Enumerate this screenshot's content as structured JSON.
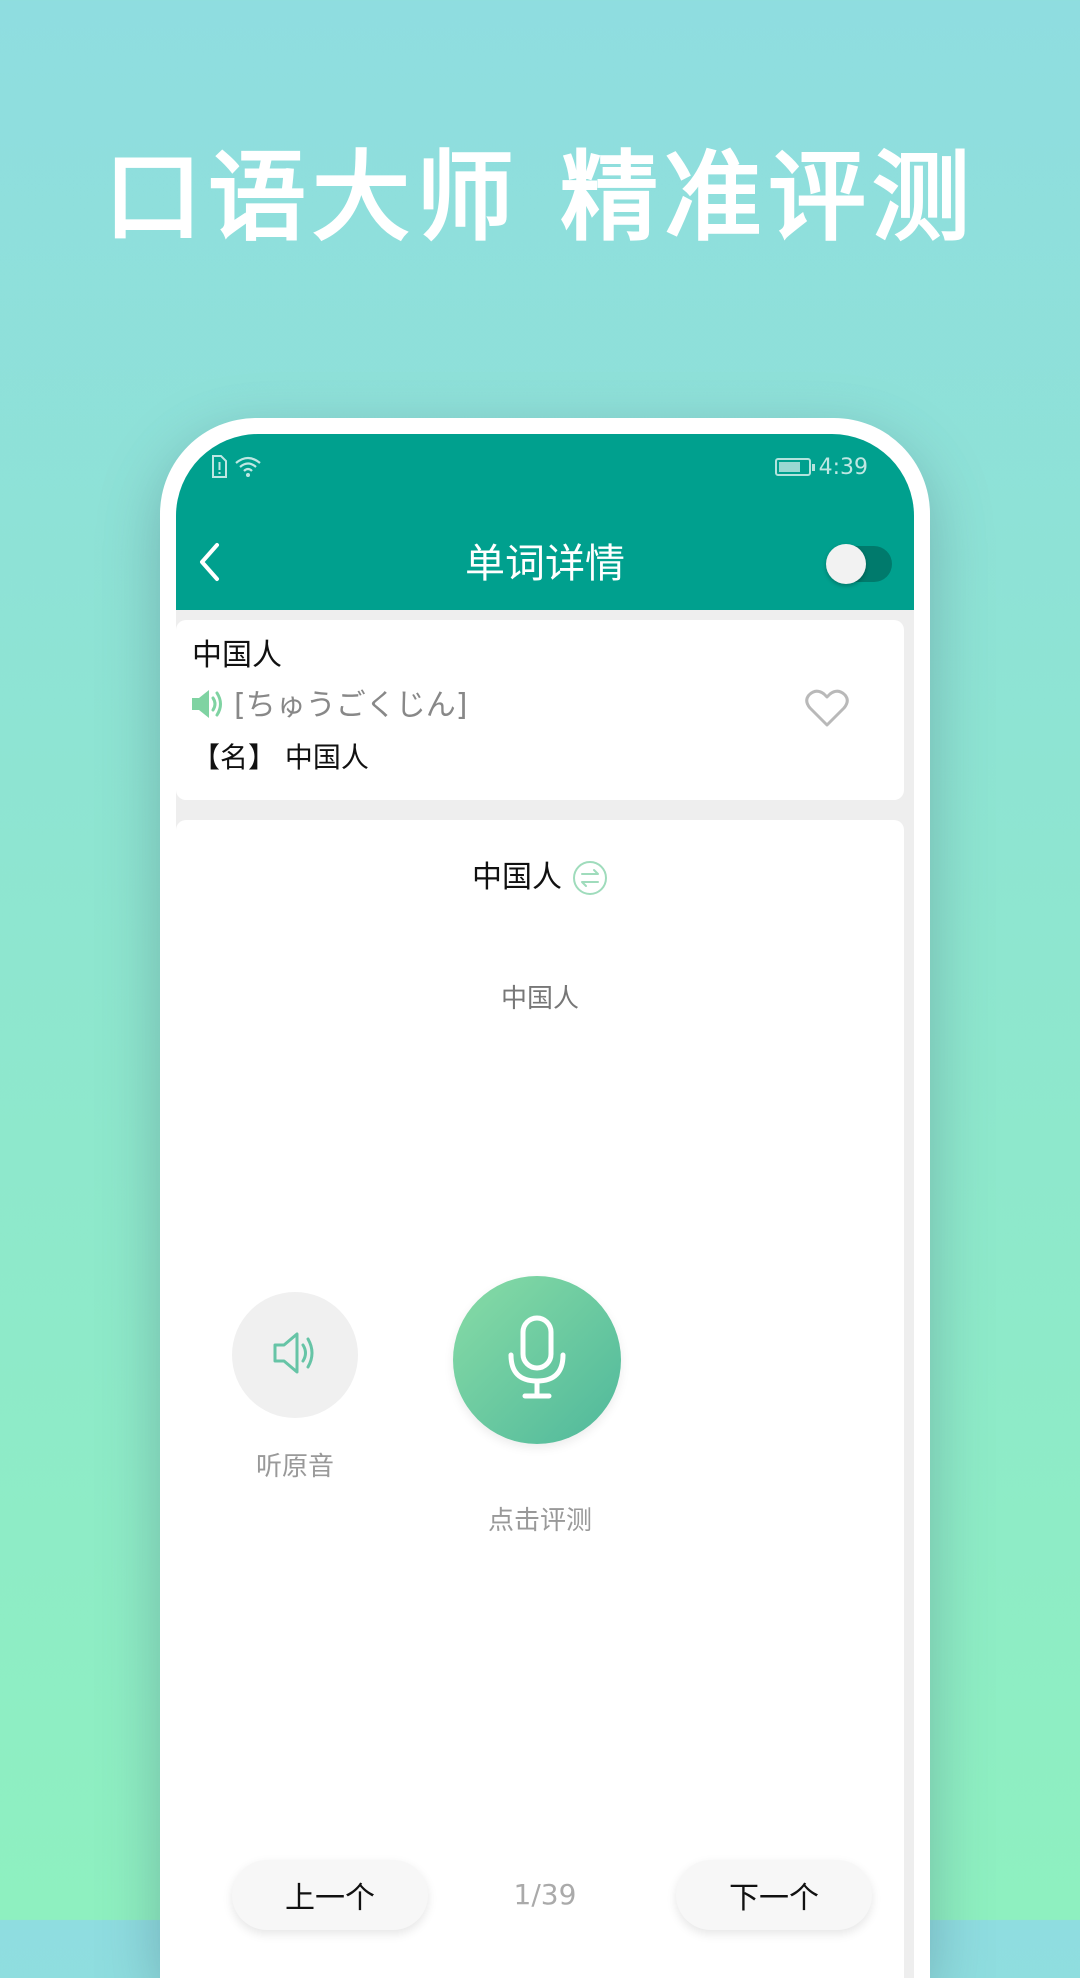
{
  "banner": {
    "headline": "口语大师 精准评测"
  },
  "status_bar": {
    "time": "4:39",
    "icons": [
      "sim-alert-icon",
      "wifi-icon",
      "battery-charging-icon"
    ],
    "battery_level": 0.75
  },
  "nav": {
    "back_icon": "chevron-left-icon",
    "title": "单词详情",
    "toggle_on": false
  },
  "word_card": {
    "word": "中国人",
    "speaker_icon": "speaker-icon",
    "pronunciation": "[ちゅうごくじん]",
    "meaning": "【名】 中国人",
    "favorite_icon": "heart-outline-icon"
  },
  "evaluation": {
    "word": "中国人",
    "swap_icon": "swap-arrows-icon",
    "reading": "中国人",
    "listen_label": "听原音",
    "record_label": "点击评测",
    "listen_icon": "speaker-icon",
    "record_icon": "microphone-icon"
  },
  "pager": {
    "prev_label": "上一个",
    "count": "1/39",
    "next_label": "下一个"
  },
  "colors": {
    "header": "#00a08e",
    "accent_green": "#5fc39e",
    "background_top": "#8fdde0",
    "background_bottom": "#8ef0c0"
  }
}
